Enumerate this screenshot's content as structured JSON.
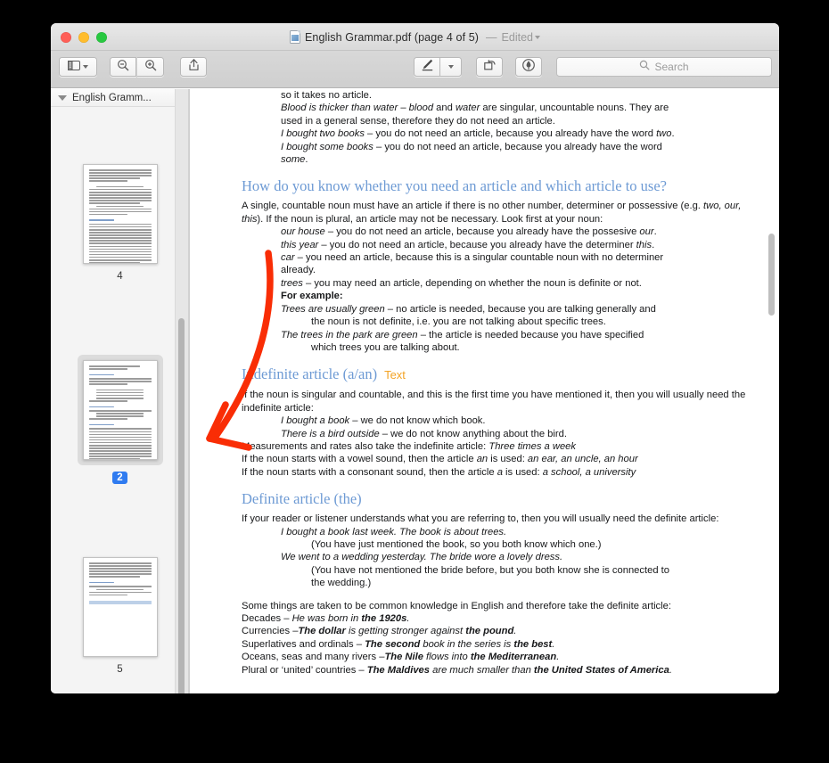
{
  "window": {
    "title_filename": "English Grammar.pdf (page 4 of 5)",
    "title_dash": "—",
    "title_status": "Edited",
    "doc_icon": "pdf-document-icon",
    "traffic_lights": [
      "close",
      "minimize",
      "maximize"
    ]
  },
  "toolbar": {
    "sidebar_button": "sidebar-toggle-icon",
    "sidebar_menu": "chevron-down-icon",
    "zoom_out": "zoom-out-icon",
    "zoom_in": "zoom-in-icon",
    "share": "share-icon",
    "markup": "markup-pen-icon",
    "markup_menu": "chevron-down-icon",
    "rotate": "rotate-icon",
    "annotate": "highlight-icon",
    "search_placeholder": "Search",
    "search_value": "",
    "search_icon": "search-icon"
  },
  "sidebar": {
    "header_label": "English Gramm...",
    "disclosure": "disclosure-triangle-icon",
    "thumbnails": [
      {
        "page_label": "4",
        "selected": false
      },
      {
        "page_label": "2",
        "selected": true
      },
      {
        "page_label": "5",
        "selected": false
      }
    ]
  },
  "annotations": {
    "arrow_color": "#f92d05",
    "text_note": "Text",
    "text_note_color": "#f3a325"
  },
  "document": {
    "blocks": [
      {
        "style": "hang2",
        "runs": [
          {
            "t": "so it takes no article.",
            "f": "n"
          }
        ]
      },
      {
        "style": "hang1",
        "runs": [
          {
            "t": "Blood is thicker than water",
            "f": "i"
          },
          {
            "t": " – ",
            "f": "n"
          },
          {
            "t": "blood",
            "f": "i"
          },
          {
            "t": " and ",
            "f": "n"
          },
          {
            "t": "water",
            "f": "i"
          },
          {
            "t": " are singular, uncountable nouns. They are",
            "f": "n"
          }
        ]
      },
      {
        "style": "hang2",
        "runs": [
          {
            "t": "used in a general sense, therefore they do not need an article.",
            "f": "n"
          }
        ]
      },
      {
        "style": "hang1",
        "runs": [
          {
            "t": "I bought two books",
            "f": "i"
          },
          {
            "t": " – you do not need an article, because you already have the word ",
            "f": "n"
          },
          {
            "t": "two",
            "f": "i"
          },
          {
            "t": ".",
            "f": "n"
          }
        ]
      },
      {
        "style": "hang1",
        "runs": [
          {
            "t": "I bought some books",
            "f": "i"
          },
          {
            "t": " – you do not need an article, because you already have the word",
            "f": "n"
          }
        ]
      },
      {
        "style": "hang2",
        "runs": [
          {
            "t": "some",
            "f": "i"
          },
          {
            "t": ".",
            "f": "n"
          }
        ]
      },
      {
        "style": "heading",
        "runs": [
          {
            "t": "How do you know whether you need an article and which article to use?",
            "f": "n"
          }
        ]
      },
      {
        "style": "body",
        "runs": [
          {
            "t": "A single, countable noun must have an article if there is no other number, determiner or possessive (e.g. ",
            "f": "n"
          },
          {
            "t": "two, our, this",
            "f": "i"
          },
          {
            "t": "). If the noun is plural, an article may not be necessary. Look first at your noun:",
            "f": "n"
          }
        ]
      },
      {
        "style": "hang1",
        "runs": [
          {
            "t": "our house",
            "f": "i"
          },
          {
            "t": " – you do not need an article, because you already have the possesive ",
            "f": "n"
          },
          {
            "t": "our",
            "f": "i"
          },
          {
            "t": ".",
            "f": "n"
          }
        ]
      },
      {
        "style": "hang1",
        "runs": [
          {
            "t": "this year",
            "f": "i"
          },
          {
            "t": " – you do not need an article, because you already have the determiner ",
            "f": "n"
          },
          {
            "t": "this",
            "f": "i"
          },
          {
            "t": ".",
            "f": "n"
          }
        ]
      },
      {
        "style": "hang1",
        "runs": [
          {
            "t": "car",
            "f": "i"
          },
          {
            "t": " – you need an article, because this is a singular countable noun with no determiner",
            "f": "n"
          }
        ]
      },
      {
        "style": "hang2",
        "runs": [
          {
            "t": "already.",
            "f": "n"
          }
        ]
      },
      {
        "style": "hang1",
        "runs": [
          {
            "t": "trees",
            "f": "i"
          },
          {
            "t": " – you may need an article, depending on whether the noun is definite or not.",
            "f": "n"
          }
        ]
      },
      {
        "style": "hang2",
        "runs": [
          {
            "t": "For example:",
            "f": "b"
          }
        ]
      },
      {
        "style": "hang2",
        "runs": [
          {
            "t": "Trees are usually green",
            "f": "i"
          },
          {
            "t": " – no article is needed, because you are talking generally and",
            "f": "n"
          }
        ]
      },
      {
        "style": "hang3",
        "runs": [
          {
            "t": "the noun is not definite, i.e. you are not talking about specific trees.",
            "f": "n"
          }
        ]
      },
      {
        "style": "hang2",
        "runs": [
          {
            "t": "The trees in the park are green",
            "f": "i"
          },
          {
            "t": " – the article is needed because you have specified",
            "f": "n"
          }
        ]
      },
      {
        "style": "hang3",
        "runs": [
          {
            "t": "which trees you are talking about.",
            "f": "n"
          }
        ]
      },
      {
        "style": "heading-note",
        "runs": [
          {
            "t": "Indefinite article (a/an)",
            "f": "n"
          }
        ],
        "note": "Text"
      },
      {
        "style": "body",
        "runs": [
          {
            "t": "If the noun is singular and countable, and this is the first time you have mentioned it, then you will usually need the indefinite article:",
            "f": "n"
          }
        ]
      },
      {
        "style": "hang2",
        "runs": [
          {
            "t": "I bought a book",
            "f": "i"
          },
          {
            "t": " – we do not know which book.",
            "f": "n"
          }
        ]
      },
      {
        "style": "hang2",
        "runs": [
          {
            "t": "There is a bird outside",
            "f": "i"
          },
          {
            "t": " – we do not know anything about the bird.",
            "f": "n"
          }
        ]
      },
      {
        "style": "body",
        "runs": [
          {
            "t": "Measurements and rates also take the indefinite article: ",
            "f": "n"
          },
          {
            "t": "Three times a week",
            "f": "i"
          }
        ]
      },
      {
        "style": "body",
        "runs": [
          {
            "t": "If the noun starts with a vowel sound, then the article ",
            "f": "n"
          },
          {
            "t": "an",
            "f": "i"
          },
          {
            "t": " is used: ",
            "f": "n"
          },
          {
            "t": "an ear, an uncle, an hour",
            "f": "i"
          }
        ]
      },
      {
        "style": "body",
        "runs": [
          {
            "t": "If the noun starts with a consonant sound, then the article ",
            "f": "n"
          },
          {
            "t": "a",
            "f": "i"
          },
          {
            "t": " is used: ",
            "f": "n"
          },
          {
            "t": "a school, a university",
            "f": "i"
          }
        ]
      },
      {
        "style": "heading",
        "runs": [
          {
            "t": "Definite article (the)",
            "f": "n"
          }
        ]
      },
      {
        "style": "body",
        "runs": [
          {
            "t": "If your reader or listener understands what you are referring to, then you will usually need the definite article:",
            "f": "n"
          }
        ]
      },
      {
        "style": "hang2",
        "runs": [
          {
            "t": "I bought a book last week. The book is about trees.",
            "f": "i"
          }
        ]
      },
      {
        "style": "hang3",
        "runs": [
          {
            "t": "(You have just mentioned the book, so you both know which one.)",
            "f": "n"
          }
        ]
      },
      {
        "style": "hang2",
        "runs": [
          {
            "t": "We went to a wedding yesterday. The bride wore a lovely dress.",
            "f": "i"
          }
        ]
      },
      {
        "style": "hang3",
        "runs": [
          {
            "t": "(You have not mentioned the bride before, but you both know she is connected to",
            "f": "n"
          }
        ]
      },
      {
        "style": "hang3",
        "runs": [
          {
            "t": "the wedding.)",
            "f": "n"
          }
        ]
      },
      {
        "style": "body-gap",
        "runs": [
          {
            "t": "Some things are taken to be common knowledge in English and therefore take the definite article:",
            "f": "n"
          }
        ]
      },
      {
        "style": "body",
        "runs": [
          {
            "t": "Decades – ",
            "f": "n"
          },
          {
            "t": "He was born in ",
            "f": "i"
          },
          {
            "t": "the 1920s",
            "f": "bi"
          },
          {
            "t": ".",
            "f": "i"
          }
        ]
      },
      {
        "style": "body",
        "runs": [
          {
            "t": "Currencies –",
            "f": "n"
          },
          {
            "t": "The dollar",
            "f": "bi"
          },
          {
            "t": " is getting stronger against ",
            "f": "i"
          },
          {
            "t": "the pound",
            "f": "bi"
          },
          {
            "t": ".",
            "f": "i"
          }
        ]
      },
      {
        "style": "body",
        "runs": [
          {
            "t": "Superlatives and ordinals – ",
            "f": "n"
          },
          {
            "t": "The second",
            "f": "bi"
          },
          {
            "t": " book in the series is ",
            "f": "i"
          },
          {
            "t": "the best",
            "f": "bi"
          },
          {
            "t": ".",
            "f": "i"
          }
        ]
      },
      {
        "style": "body",
        "runs": [
          {
            "t": "Oceans, seas and many rivers –",
            "f": "n"
          },
          {
            "t": "The Nile",
            "f": "bi"
          },
          {
            "t": " flows into ",
            "f": "i"
          },
          {
            "t": "the Mediterranean",
            "f": "bi"
          },
          {
            "t": ".",
            "f": "i"
          }
        ]
      },
      {
        "style": "body",
        "runs": [
          {
            "t": "Plural or ‘united’ countries – ",
            "f": "n"
          },
          {
            "t": "The Maldives",
            "f": "bi"
          },
          {
            "t": " are much smaller than ",
            "f": "i"
          },
          {
            "t": "the United States of America",
            "f": "bi"
          },
          {
            "t": ".",
            "f": "i"
          }
        ]
      }
    ]
  }
}
